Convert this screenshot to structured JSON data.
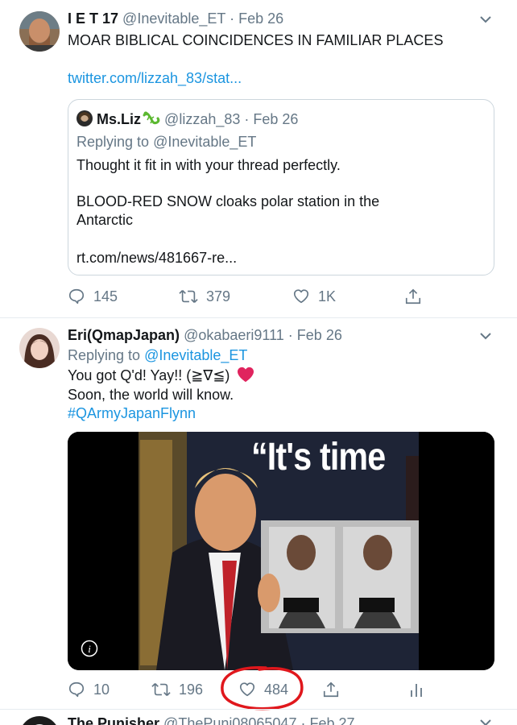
{
  "tweet1": {
    "name": "I E T 17",
    "handle": "@Inevitable_ET",
    "separator": "·",
    "date": "Feb 26",
    "text": "MOAR BIBLICAL COINCIDENCES IN FAMILIAR PLACES",
    "link": "twitter.com/lizzah_83/stat...",
    "quote": {
      "name": "Ms.Liz",
      "handle": "@lizzah_83",
      "separator": "·",
      "date": "Feb 26",
      "replying_prefix": "Replying to",
      "replying_handle": "@Inevitable_ET",
      "text1": "Thought it fit in with your thread perfectly.",
      "text2_line1": "BLOOD-RED SNOW cloaks polar station in the",
      "text2_line2": "Antarctic",
      "link": "rt.com/news/481667-re..."
    },
    "actions": {
      "replies": "145",
      "retweets": "379",
      "likes": "1K"
    }
  },
  "tweet2": {
    "name": "Eri(QmapJapan)",
    "handle": "@okabaeri9111",
    "separator": "·",
    "date": "Feb 26",
    "replying_prefix": "Replying to",
    "replying_handle": "@Inevitable_ET",
    "line1": "You got Q'd! Yay!! (≧∇≦)",
    "line2": "Soon, the world will know.",
    "hashtag": "#QArmyJapanFlynn",
    "image_caption": "“It's time",
    "actions": {
      "replies": "10",
      "retweets": "196",
      "likes": "484"
    }
  },
  "tweet3": {
    "name": "The Punisher",
    "handle": "@ThePuni08065047",
    "separator": "·",
    "date": "Feb 27"
  },
  "colors": {
    "link": "#1b95e0",
    "muted": "#657786",
    "annotation": "#e0171c",
    "heart": "#e0245e"
  },
  "icons": [
    "chevron-down-icon",
    "reply-icon",
    "retweet-icon",
    "like-icon",
    "share-icon",
    "analytics-icon",
    "info-icon",
    "gecko-emoji-icon",
    "heart-emoji-icon"
  ]
}
